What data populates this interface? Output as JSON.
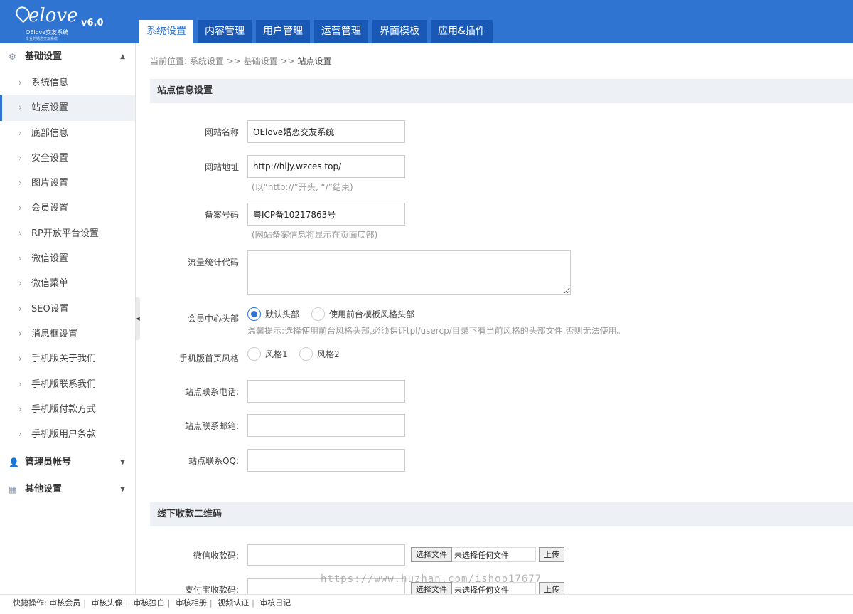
{
  "header": {
    "logo_script": "elove",
    "logo_subtitle": "OElove交友系统",
    "logo_tagline": "专业的婚恋交友系统",
    "version": "v6.0",
    "tabs": [
      {
        "label": "系统设置"
      },
      {
        "label": "内容管理"
      },
      {
        "label": "用户管理"
      },
      {
        "label": "运营管理"
      },
      {
        "label": "界面模板"
      },
      {
        "label": "应用&插件"
      }
    ],
    "active_tab": "系统设置",
    "accent_color": "#2f74d0"
  },
  "sidebar": {
    "groups": [
      {
        "label": "基础设置",
        "icon": "gear-icon",
        "expanded": true
      },
      {
        "label": "管理员帐号",
        "icon": "user-icon",
        "expanded": false
      },
      {
        "label": "其他设置",
        "icon": "grid-icon",
        "expanded": false
      }
    ],
    "items": [
      {
        "label": "系统信息"
      },
      {
        "label": "站点设置"
      },
      {
        "label": "底部信息"
      },
      {
        "label": "安全设置"
      },
      {
        "label": "图片设置"
      },
      {
        "label": "会员设置"
      },
      {
        "label": "RP开放平台设置"
      },
      {
        "label": "微信设置"
      },
      {
        "label": "微信菜单"
      },
      {
        "label": "SEO设置"
      },
      {
        "label": "消息框设置"
      },
      {
        "label": "手机版关于我们"
      },
      {
        "label": "手机版联系我们"
      },
      {
        "label": "手机版付款方式"
      },
      {
        "label": "手机版用户条款"
      }
    ],
    "active_item": "站点设置"
  },
  "breadcrumb": {
    "prefix": "当前位置:",
    "level1": "系统设置",
    "sep": ">>",
    "level2": "基础设置",
    "current": "站点设置"
  },
  "site_info": {
    "section_title": "站点信息设置",
    "site_name": {
      "label": "网站名称",
      "value": "OElove婚恋交友系统"
    },
    "site_url": {
      "label": "网站地址",
      "value": "http://hljy.wzces.top/",
      "hint": "(以“http://”开头, “/”结束)"
    },
    "icp": {
      "label": "备案号码",
      "value": "粤ICP备10217863号",
      "hint": "(网站备案信息将显示在页面底部)"
    },
    "stats_code": {
      "label": "流量统计代码",
      "value": ""
    },
    "member_header": {
      "label": "会员中心头部",
      "options": [
        "默认头部",
        "使用前台模板风格头部"
      ],
      "selected": "默认头部",
      "hint": "温馨提示:选择使用前台风格头部,必须保证tpl/usercp/目录下有当前风格的头部文件,否则无法使用。"
    },
    "mobile_style": {
      "label": "手机版首页风格",
      "options": [
        "风格1",
        "风格2"
      ]
    },
    "phone": {
      "label": "站点联系电话:",
      "value": ""
    },
    "email": {
      "label": "站点联系邮箱:",
      "value": ""
    },
    "qq": {
      "label": "站点联系QQ:",
      "value": ""
    }
  },
  "offline_pay": {
    "section_title": "线下收款二维码",
    "wechat": {
      "label": "微信收款码:",
      "value": ""
    },
    "alipay": {
      "label": "支付宝收款码:",
      "value": ""
    },
    "choose_file_label": "选择文件",
    "no_file_text": "未选择任何文件",
    "upload_label": "上传"
  },
  "watermark": "https://www.huzhan.com/ishop17677",
  "footer": {
    "prefix": "快捷操作:",
    "links": [
      "审核会员",
      "审核头像",
      "审核独白",
      "审核相册",
      "视频认证",
      "审核日记"
    ]
  }
}
